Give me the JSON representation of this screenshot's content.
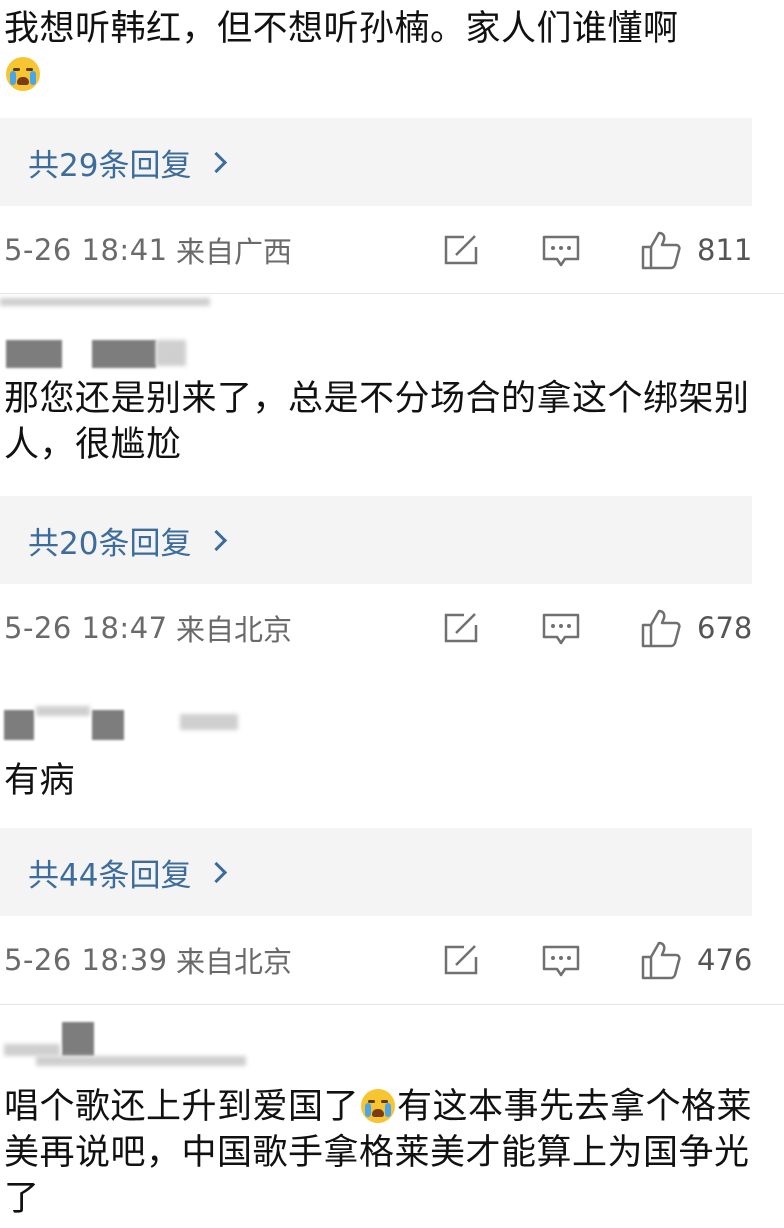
{
  "comments": [
    {
      "text": "我想听韩红，但不想听孙楠。家人们谁懂啊",
      "reply_label": "共29条回复",
      "time": "5-26 18:41",
      "location": "来自广西",
      "likes": "811"
    },
    {
      "text": "那您还是别来了，总是不分场合的拿这个绑架别人，很尴尬",
      "reply_label": "共20条回复",
      "time": "5-26 18:47",
      "location": "来自北京",
      "likes": "678"
    },
    {
      "text": "有病",
      "reply_label": "共44条回复",
      "time": "5-26 18:39",
      "location": "来自北京",
      "likes": "476"
    },
    {
      "text_part1": "唱个歌还上升到爱国了",
      "text_part2": "有这本事先去拿个格莱美再说吧，中国歌手拿格莱美才能算上为国争光了"
    }
  ],
  "icons": {
    "emoji": "crying-face",
    "repost": "edit-icon",
    "comment": "comment-icon",
    "like": "thumbs-up-icon"
  },
  "colors": {
    "link": "#3c6c9c",
    "meta": "#6a6a6a",
    "reply_bg": "#f4f4f4"
  }
}
